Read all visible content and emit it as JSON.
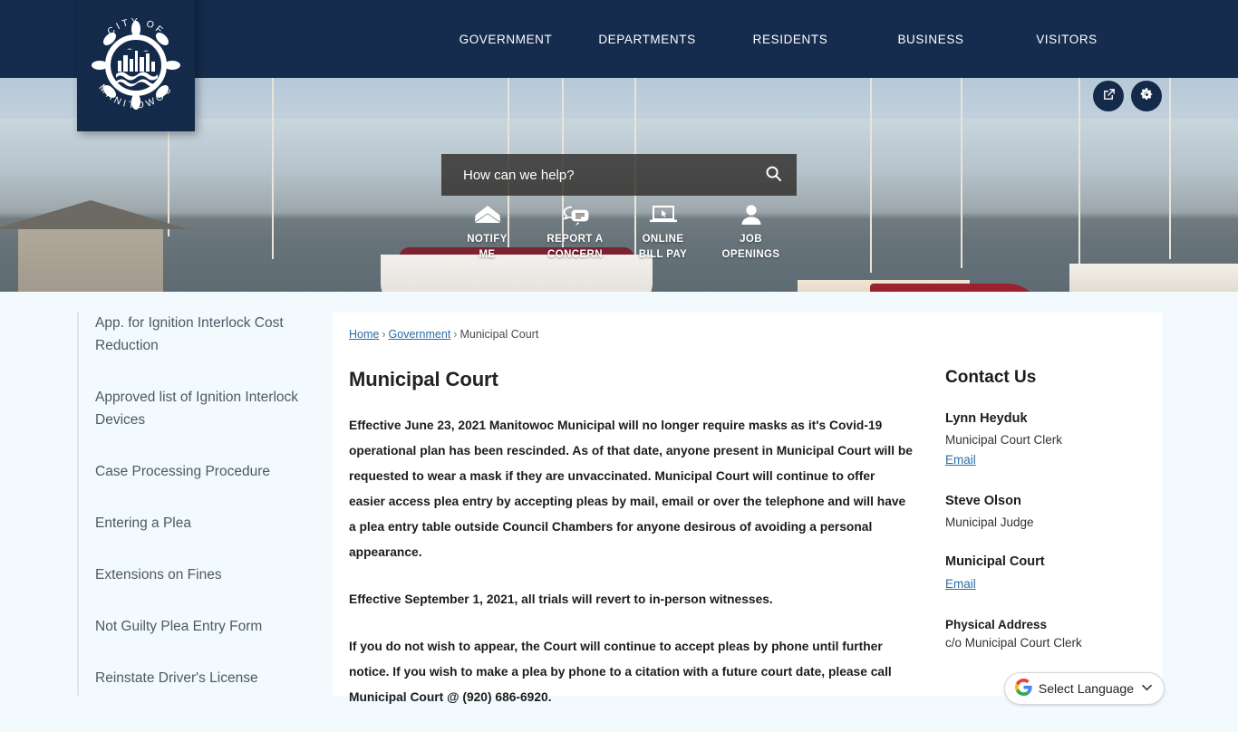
{
  "site": {
    "logo_line1": "CITY OF",
    "logo_line2": "MANITOWOC"
  },
  "nav": {
    "items": [
      {
        "label": "GOVERNMENT"
      },
      {
        "label": "DEPARTMENTS"
      },
      {
        "label": "RESIDENTS"
      },
      {
        "label": "BUSINESS"
      },
      {
        "label": "VISITORS"
      }
    ]
  },
  "actions": {
    "share_icon": "share-icon",
    "settings_icon": "gear-icon"
  },
  "search": {
    "placeholder": "How can we help?",
    "value": "",
    "button_icon": "search-icon"
  },
  "quicklinks": [
    {
      "icon": "envelope-icon",
      "line1": "NOTIFY",
      "line2": "ME"
    },
    {
      "icon": "speech-bubbles-icon",
      "line1": "REPORT A",
      "line2": "CONCERN"
    },
    {
      "icon": "laptop-cursor-icon",
      "line1": "ONLINE",
      "line2": "BILL PAY"
    },
    {
      "icon": "person-icon",
      "line1": "JOB",
      "line2": "OPENINGS"
    }
  ],
  "sidebar": {
    "items": [
      {
        "label": "App. for Ignition Interlock Cost Reduction"
      },
      {
        "label": "Approved list of Ignition Interlock Devices"
      },
      {
        "label": "Case Processing Procedure"
      },
      {
        "label": "Entering a Plea"
      },
      {
        "label": "Extensions on Fines"
      },
      {
        "label": "Not Guilty Plea Entry Form"
      },
      {
        "label": "Reinstate Driver's License"
      }
    ]
  },
  "breadcrumb": {
    "home": "Home",
    "government": "Government",
    "current": "Municipal Court",
    "separator": "›"
  },
  "main": {
    "title": "Municipal Court",
    "paragraphs": [
      "Effective June 23, 2021 Manitowoc Municipal will no longer require masks as it's Covid-19 operational plan has been rescinded.  As of that date, anyone present in Municipal Court will be requested to wear a mask if they are unvaccinated. Municipal Court will continue to offer easier access plea entry by accepting pleas by mail, email or over the telephone and will have a plea entry table outside Council Chambers for anyone desirous of avoiding a personal appearance.",
      "Effective September 1, 2021, all trials will revert to in-person witnesses.",
      "If you do not wish to appear, the Court will continue to accept pleas by phone until further notice.  If you wish to make a plea by phone to a citation with a future court date, please call Municipal Court @  (920) 686-6920."
    ]
  },
  "contact": {
    "title": "Contact Us",
    "people": [
      {
        "name": "Lynn Heyduk",
        "role": "Municipal Court Clerk",
        "email_label": "Email"
      },
      {
        "name": "Steve Olson",
        "role": "Municipal Judge",
        "email_label": ""
      },
      {
        "name": "Municipal Court",
        "role": "",
        "email_label": "Email"
      }
    ],
    "address_label": "Physical Address",
    "address_line1": "c/o Municipal Court Clerk"
  },
  "translate": {
    "label": "Select Language",
    "icon": "google-g-icon",
    "caret": "⌄"
  },
  "colors": {
    "navy": "#152c4e",
    "page_bg": "#f2fafd",
    "link_blue": "#2b6da8",
    "panel_white": "#ffffff"
  }
}
